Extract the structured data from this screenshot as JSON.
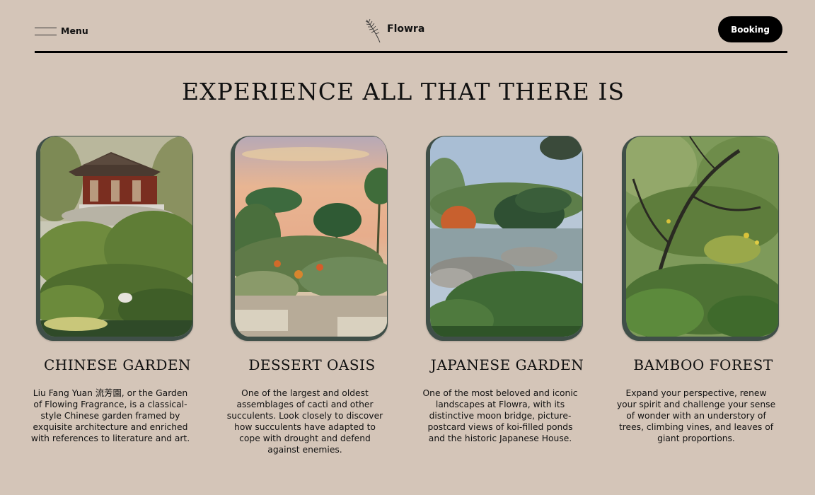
{
  "header": {
    "menu_label": "Menu",
    "logo_text": "Flowra",
    "booking_label": "Booking"
  },
  "section": {
    "title": "EXPERIENCE ALL THAT THERE IS"
  },
  "cards": [
    {
      "title": "CHINESE GARDEN",
      "description": "Liu Fang Yuan 流芳園, or the Garden of Flowing Fragrance, is a classical-style Chinese garden framed by exquisite architecture and enriched with references to literature and art."
    },
    {
      "title": "DESSERT OASIS",
      "description": "One of the largest and oldest assemblages of cacti and other succulents. Look closely to discover how succulents have adapted to cope with drought and defend against enemies."
    },
    {
      "title": "JAPANESE GARDEN",
      "description": "One of the most beloved and iconic landscapes at Flowra, with its distinctive moon bridge, picture-postcard views of koi-filled ponds and the historic Japanese House."
    },
    {
      "title": "BAMBOO FOREST",
      "description": "Expand your perspective, renew your spirit and challenge your sense of wonder with an understory of trees, climbing vines, and leaves of giant proportions."
    }
  ],
  "colors": {
    "background": "#d4c5b8",
    "frame": "#3f4f48",
    "button": "#000000"
  }
}
